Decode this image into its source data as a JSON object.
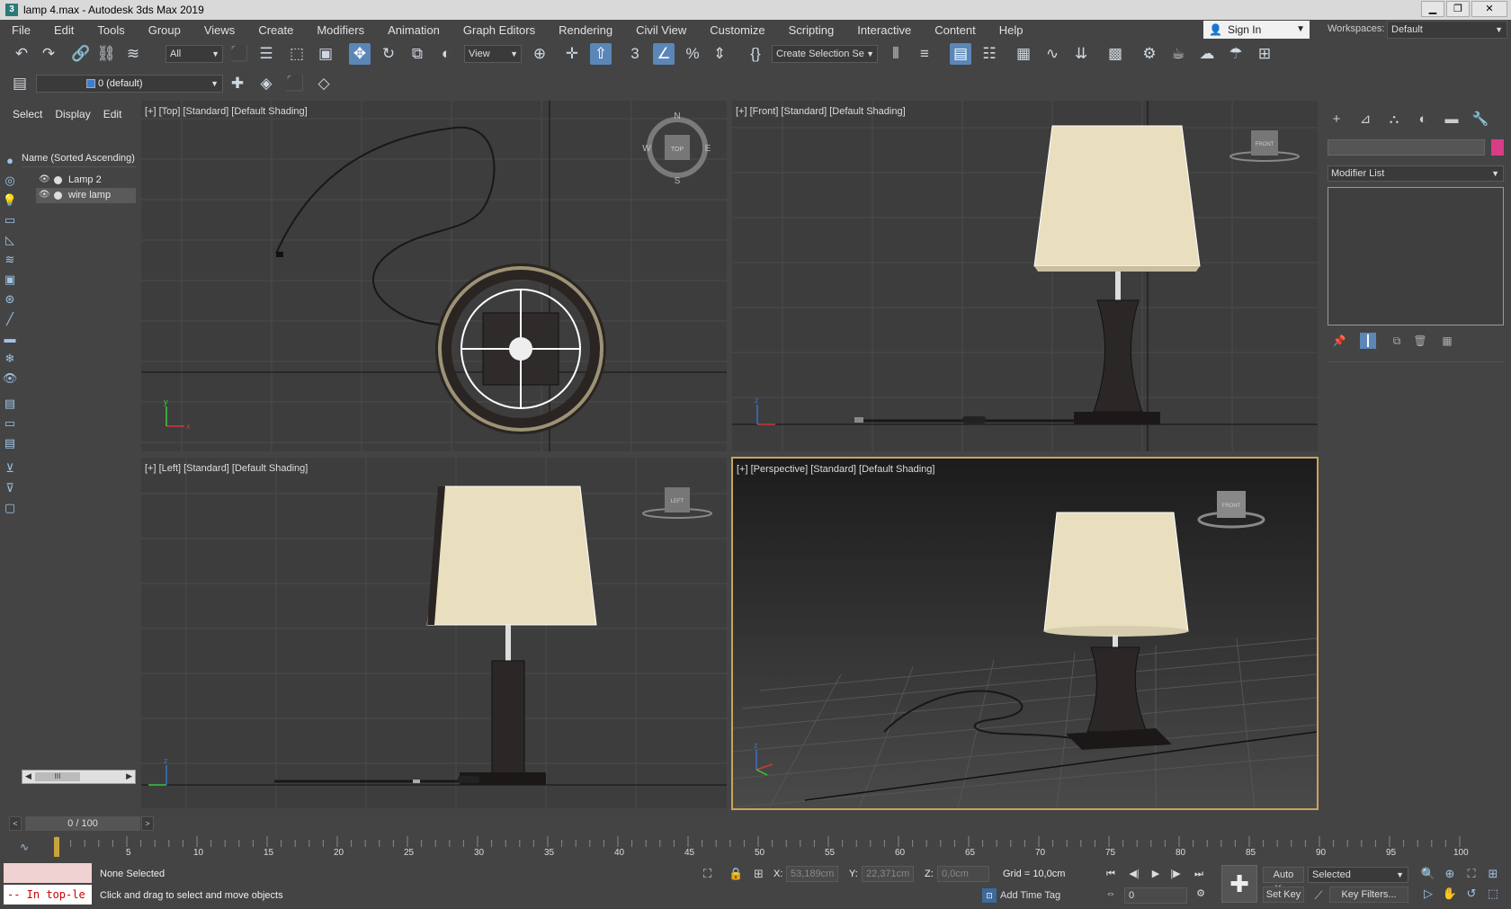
{
  "window": {
    "title": "lamp 4.max - Autodesk 3ds Max 2019",
    "app_icon": "3ds-max-icon",
    "minimize": "▁",
    "maximize": "❐",
    "close": "✕"
  },
  "menu": [
    "File",
    "Edit",
    "Tools",
    "Group",
    "Views",
    "Create",
    "Modifiers",
    "Animation",
    "Graph Editors",
    "Rendering",
    "Civil View",
    "Customize",
    "Scripting",
    "Interactive",
    "Content",
    "Help"
  ],
  "signin": {
    "label": "Sign In"
  },
  "workspaces": {
    "label": "Workspaces:",
    "value": "Default"
  },
  "toolbar": {
    "selection_filter": "All",
    "ref_coord": "View",
    "named_selection": "Create Selection Se"
  },
  "layer": {
    "current": "0 (default)"
  },
  "scene_explorer": {
    "tabs": [
      "Select",
      "Display",
      "Edit"
    ],
    "column_header": "Name (Sorted Ascending)",
    "items": [
      "Lamp 2",
      "wire lamp"
    ],
    "scroll_thumb": "III"
  },
  "viewports": {
    "top": "[+] [Top] [Standard] [Default Shading]",
    "front": "[+] [Front] [Standard] [Default Shading]",
    "left": "[+] [Left] [Standard] [Default Shading]",
    "perspective": "[+] [Perspective] [Standard] [Default Shading]",
    "viewcube_top": "TOP",
    "viewcube_front": "FRONT",
    "viewcube_left": "LEFT",
    "compass": {
      "n": "N",
      "s": "S",
      "e": "E",
      "w": "W"
    },
    "axis": {
      "x": "x",
      "y": "y",
      "z": "z"
    }
  },
  "command_panel": {
    "modifier_list": "Modifier List"
  },
  "time_slider": {
    "value": "0 / 100",
    "prev": "<",
    "next": ">",
    "labels": [
      "5",
      "10",
      "15",
      "20",
      "25",
      "30",
      "35",
      "40",
      "45",
      "50",
      "55",
      "60",
      "65",
      "70",
      "75",
      "80",
      "85",
      "90",
      "95",
      "100"
    ]
  },
  "status": {
    "maxscript": "-- In top-le",
    "selection": "None Selected",
    "prompt": "Click and drag to select and move objects",
    "x_label": "X:",
    "x_value": "53,189cm",
    "y_label": "Y:",
    "y_value": "22,371cm",
    "z_label": "Z:",
    "z_value": "0,0cm",
    "grid": "Grid = 10,0cm",
    "add_time_tag": "Add Time Tag",
    "auto_key": "Auto Key",
    "set_key": "Set Key",
    "key_mode": "Selected",
    "key_filters": "Key Filters...",
    "frame": "0"
  },
  "colors": {
    "accent": "#5a87b8",
    "active_viewport": "#c9a45a",
    "object_color": "#d63d86",
    "shade": "#e9dfbf"
  }
}
